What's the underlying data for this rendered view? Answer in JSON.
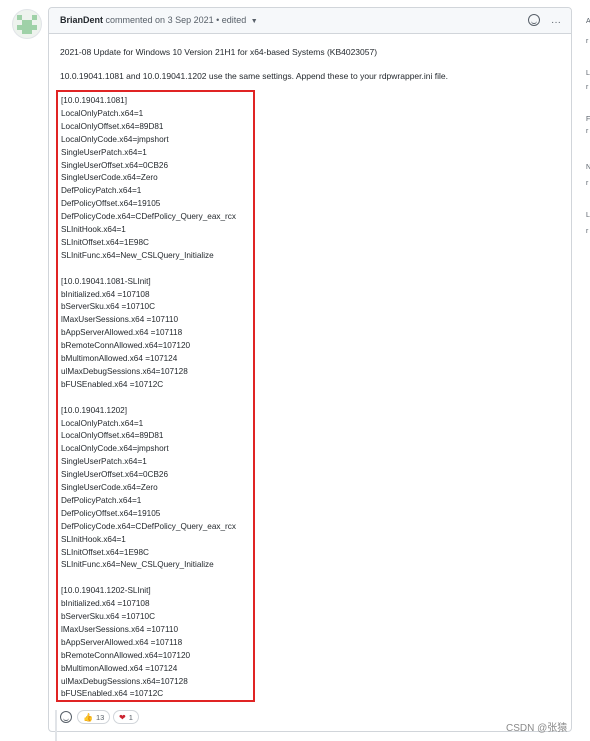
{
  "header": {
    "author": "BrianDent",
    "meta": "commented on 3 Sep 2021 • edited"
  },
  "body": {
    "title": "2021-08 Update for Windows 10 Version 21H1 for x64-based Systems (KB4023057)",
    "note": "10.0.19041.1081 and 10.0.19041.1202 use the same settings. Append these to your rdpwrapper.ini file.",
    "code_lines": [
      "[10.0.19041.1081]",
      "LocalOnlyPatch.x64=1",
      "LocalOnlyOffset.x64=89D81",
      "LocalOnlyCode.x64=jmpshort",
      "SingleUserPatch.x64=1",
      "SingleUserOffset.x64=0CB26",
      "SingleUserCode.x64=Zero",
      "DefPolicyPatch.x64=1",
      "DefPolicyOffset.x64=19105",
      "DefPolicyCode.x64=CDefPolicy_Query_eax_rcx",
      "SLInitHook.x64=1",
      "SLInitOffset.x64=1E98C",
      "SLInitFunc.x64=New_CSLQuery_Initialize",
      "",
      "[10.0.19041.1081-SLInit]",
      "bInitialized.x64 =107108",
      "bServerSku.x64 =10710C",
      "lMaxUserSessions.x64 =107110",
      "bAppServerAllowed.x64 =107118",
      "bRemoteConnAllowed.x64=107120",
      "bMultimonAllowed.x64 =107124",
      "ulMaxDebugSessions.x64=107128",
      "bFUSEnabled.x64 =10712C",
      "",
      "[10.0.19041.1202]",
      "LocalOnlyPatch.x64=1",
      "LocalOnlyOffset.x64=89D81",
      "LocalOnlyCode.x64=jmpshort",
      "SingleUserPatch.x64=1",
      "SingleUserOffset.x64=0CB26",
      "SingleUserCode.x64=Zero",
      "DefPolicyPatch.x64=1",
      "DefPolicyOffset.x64=19105",
      "DefPolicyCode.x64=CDefPolicy_Query_eax_rcx",
      "SLInitHook.x64=1",
      "SLInitOffset.x64=1E98C",
      "SLInitFunc.x64=New_CSLQuery_Initialize",
      "",
      "[10.0.19041.1202-SLInit]",
      "bInitialized.x64 =107108",
      "bServerSku.x64 =10710C",
      "lMaxUserSessions.x64 =107110",
      "bAppServerAllowed.x64 =107118",
      "bRemoteConnAllowed.x64=107120",
      "bMultimonAllowed.x64 =107124",
      "ulMaxDebugSessions.x64=107128",
      "bFUSEnabled.x64 =10712C"
    ]
  },
  "reactions": [
    {
      "emoji": "👍",
      "count": "13"
    },
    {
      "emoji": "❤",
      "count": "1"
    }
  ],
  "watermark": "CSDN @张猿",
  "sidebar_letters": [
    "A",
    "r",
    "L",
    "r",
    "F",
    "r",
    "N",
    "r",
    "L",
    "r"
  ],
  "colors": {
    "highlight_border": "#e02424",
    "header_bg": "#f6f8fa",
    "border": "#d1d5da"
  }
}
